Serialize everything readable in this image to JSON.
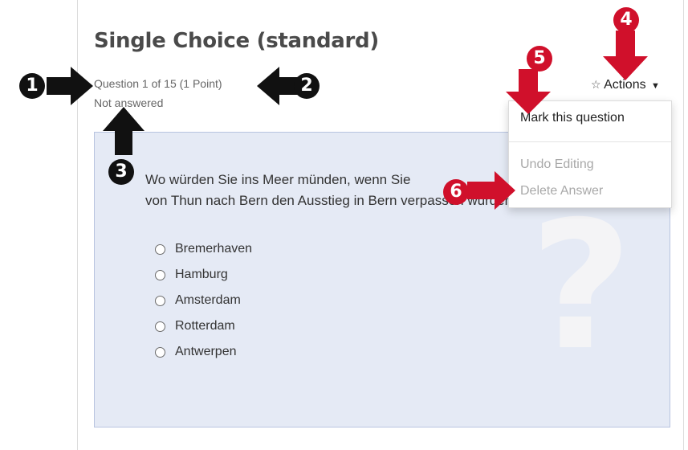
{
  "question": {
    "title": "Single Choice (standard)",
    "counter": "Question 1 of 15 (1 Point)",
    "status": "Not answered",
    "text_line1": "Wo würden Sie ins Meer münden, wenn Sie",
    "text_line2": "von Thun nach Bern den Ausstieg in Bern verpassen würden?",
    "options": [
      "Bremerhaven",
      "Hamburg",
      "Amsterdam",
      "Rotterdam",
      "Antwerpen"
    ]
  },
  "actions_menu": {
    "label": "Actions",
    "items": {
      "mark": "Mark this question",
      "undo": "Undo Editing",
      "delete": "Delete Answer"
    }
  },
  "callouts": [
    "1",
    "2",
    "3",
    "4",
    "5",
    "6"
  ],
  "colors": {
    "callout_black": "#111111",
    "callout_red": "#d0102b",
    "question_bg": "#e5eaf5"
  },
  "icons": {
    "actions": "star-outline-icon",
    "actions_caret": "caret-down-icon",
    "option": "radio-icon",
    "watermark": "question-mark-icon"
  }
}
